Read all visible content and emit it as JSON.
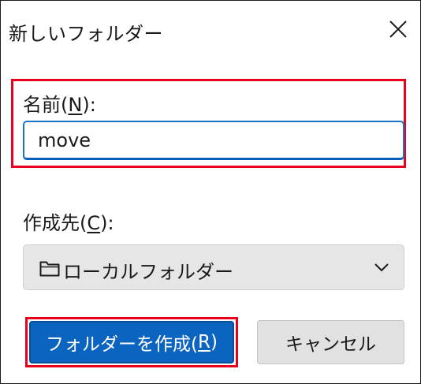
{
  "dialog": {
    "title": "新しいフォルダー",
    "close_icon": "close-icon"
  },
  "name_field": {
    "label_prefix": "名前(",
    "label_accesskey": "N",
    "label_suffix": "):",
    "value": "move"
  },
  "destination": {
    "label_prefix": "作成先(",
    "label_accesskey": "C",
    "label_suffix": "):",
    "selected": "ローカルフォルダー",
    "folder_icon": "folder-icon",
    "chevron_icon": "chevron-down-icon"
  },
  "buttons": {
    "create_prefix": "フォルダーを作成(",
    "create_accesskey": "R",
    "create_suffix": ")",
    "cancel": "キャンセル"
  },
  "colors": {
    "highlight": "#e8001c",
    "primary": "#0a64c0",
    "input_focus": "#1a73c7"
  }
}
